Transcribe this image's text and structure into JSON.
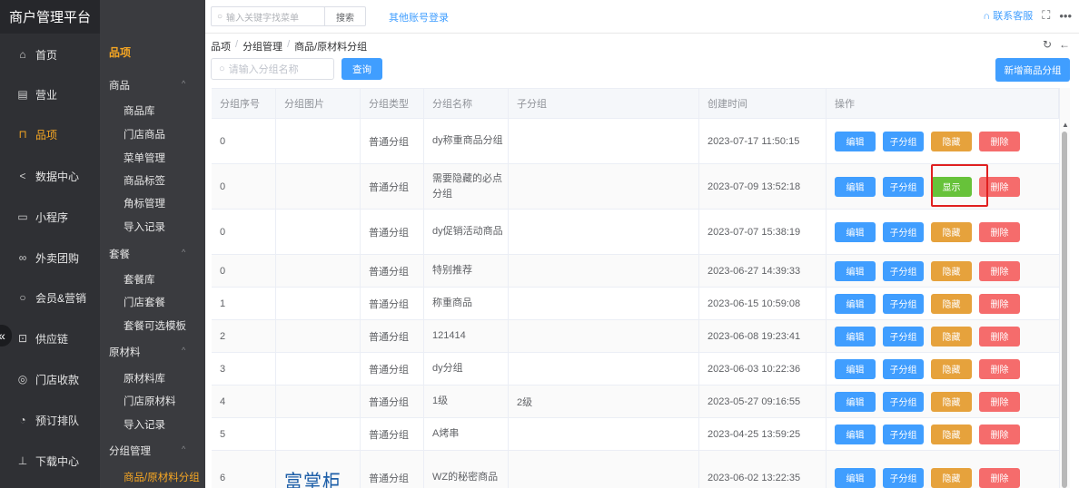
{
  "app": {
    "title": "商户管理平台"
  },
  "topbar": {
    "search_placeholder": "输入关键字找菜单",
    "search_button": "搜索",
    "other_login": "其他账号登录",
    "contact": "联系客服"
  },
  "sidebar": {
    "items": [
      {
        "label": "首页",
        "icon": "home-icon"
      },
      {
        "label": "营业",
        "icon": "calendar-icon"
      },
      {
        "label": "品项",
        "icon": "bag-icon",
        "active": true
      },
      {
        "label": "数据中心",
        "icon": "share-icon"
      },
      {
        "label": "小程序",
        "icon": "phone-icon"
      },
      {
        "label": "外卖团购",
        "icon": "bike-icon"
      },
      {
        "label": "会员&营销",
        "icon": "user-icon"
      },
      {
        "label": "供应链",
        "icon": "truck-icon"
      },
      {
        "label": "门店收款",
        "icon": "wallet-icon"
      },
      {
        "label": "预订排队",
        "icon": "clock-icon"
      },
      {
        "label": "下载中心",
        "icon": "download-icon"
      }
    ]
  },
  "submenu": {
    "header": "品项",
    "groups": [
      {
        "label": "商品",
        "items": [
          "商品库",
          "门店商品",
          "菜单管理",
          "商品标签",
          "角标管理",
          "导入记录"
        ]
      },
      {
        "label": "套餐",
        "items": [
          "套餐库",
          "门店套餐",
          "套餐可选模板"
        ]
      },
      {
        "label": "原材料",
        "items": [
          "原材料库",
          "门店原材料",
          "导入记录"
        ]
      },
      {
        "label": "分组管理",
        "items": [
          "商品/原材料分组"
        ]
      }
    ]
  },
  "breadcrumb": [
    "品项",
    "分组管理",
    "商品/原材料分组"
  ],
  "filter": {
    "placeholder": "请输入分组名称",
    "query_button": "查询",
    "add_button": "新增商品分组"
  },
  "table": {
    "columns": [
      "分组序号",
      "分组图片",
      "分组类型",
      "分组名称",
      "子分组",
      "创建时间",
      "操作"
    ],
    "rows": [
      {
        "seq": "0",
        "type": "普通分组",
        "name": "dy称重商品分组",
        "sub": "",
        "created": "2023-07-17 11:50:15",
        "hidden": false
      },
      {
        "seq": "0",
        "type": "普通分组",
        "name": "需要隐藏的必点分组",
        "sub": "",
        "created": "2023-07-09 13:52:18",
        "hidden": true
      },
      {
        "seq": "0",
        "type": "普通分组",
        "name": "dy促销活动商品",
        "sub": "",
        "created": "2023-07-07 15:38:19",
        "hidden": false
      },
      {
        "seq": "0",
        "type": "普通分组",
        "name": "特别推荐",
        "sub": "",
        "created": "2023-06-27 14:39:33",
        "hidden": false
      },
      {
        "seq": "1",
        "type": "普通分组",
        "name": "称重商品",
        "sub": "",
        "created": "2023-06-15 10:59:08",
        "hidden": false
      },
      {
        "seq": "2",
        "type": "普通分组",
        "name": "121414",
        "sub": "",
        "created": "2023-06-08 19:23:41",
        "hidden": false
      },
      {
        "seq": "3",
        "type": "普通分组",
        "name": "dy分组",
        "sub": "",
        "created": "2023-06-03 10:22:36",
        "hidden": false
      },
      {
        "seq": "4",
        "type": "普通分组",
        "name": "1级",
        "sub": "2级",
        "created": "2023-05-27 09:16:55",
        "hidden": false
      },
      {
        "seq": "5",
        "type": "普通分组",
        "name": "A烤串",
        "sub": "",
        "created": "2023-04-25 13:59:25",
        "hidden": false
      },
      {
        "seq": "6",
        "type": "普通分组",
        "name": "WZ的秘密商品",
        "sub": "",
        "created": "2023-06-02 13:22:35",
        "hidden": false,
        "image_text": "富掌柜"
      }
    ],
    "actions": {
      "edit": "编辑",
      "sub": "子分组",
      "hide": "隐藏",
      "show": "显示",
      "delete": "删除"
    }
  },
  "colors": {
    "primary": "#409eff",
    "warning": "#e6a23c",
    "success": "#67c23a",
    "danger": "#f56c6c",
    "accent": "#f5a623",
    "highlight": "#e02020"
  }
}
